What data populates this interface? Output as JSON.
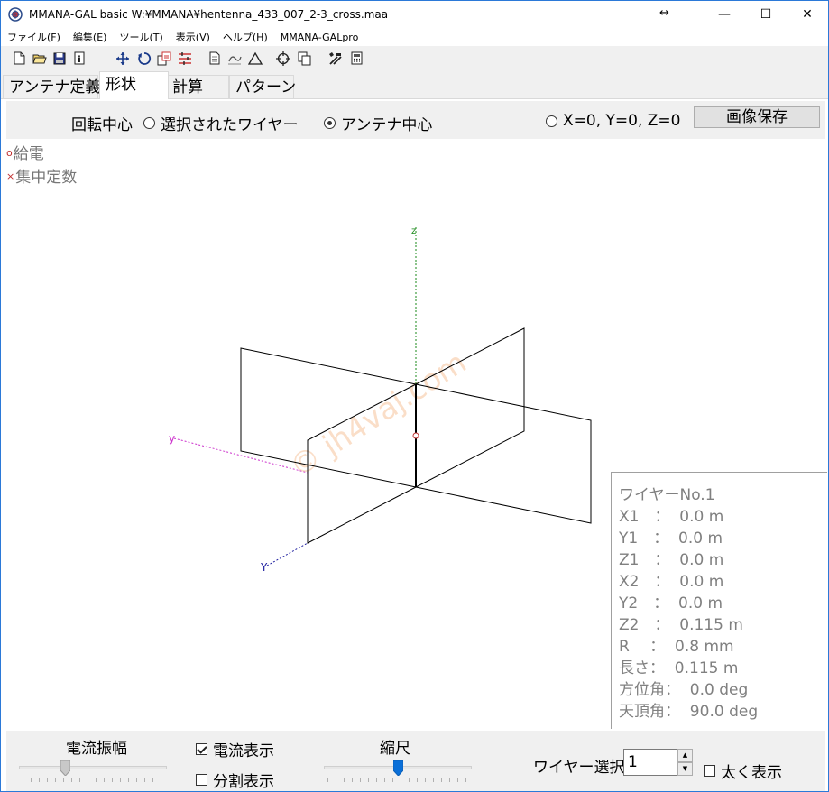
{
  "window": {
    "title": "MMANA-GAL basic W:¥MMANA¥hentenna_433_007_2-3_cross.maa",
    "resize_icon": "↔",
    "minimize": "—",
    "maximize": "☐",
    "close": "✕"
  },
  "menu": [
    "ファイル(F)",
    "編集(E)",
    "ツール(T)",
    "表示(V)",
    "ヘルプ(H)",
    "MMANA-GALpro"
  ],
  "toolbar_icons": [
    "new-file-icon",
    "open-folder-icon",
    "save-disk-icon",
    "info-icon",
    "move-arrows-icon",
    "rotate-icon",
    "copy-icon",
    "wire-list-icon",
    "document-icon",
    "draw-icon",
    "triangle-icon",
    "target-icon",
    "duplicate-icon",
    "tools-icon",
    "calculator-icon"
  ],
  "tabs": [
    "アンテナ定義",
    "形状",
    "計算",
    "パターン"
  ],
  "active_tab": "形状",
  "rotation": {
    "label": "回転中心",
    "option_wire": "選択されたワイヤー",
    "option_center": "アンテナ中心",
    "option_xyz": "X=0, Y=0, Z=0",
    "selected": "アンテナ中心",
    "save_button": "画像保存"
  },
  "legend": {
    "feed": "給電",
    "feed_mark": "o",
    "load": "集中定数",
    "load_mark": "×"
  },
  "axes": {
    "z_label": "z",
    "y_label": "y",
    "x_label": "Y",
    "watermark": "© jh4vaj.com"
  },
  "wire_info": {
    "title": "ワイヤーNo.1",
    "lines": [
      "X1　：  0.0 m",
      "Y1　：  0.0 m",
      "Z1　：  0.0 m",
      "X2　：  0.0 m",
      "Y2　：  0.0 m",
      "Z2　：  0.115 m",
      "R　 ：  0.8 mm",
      "長さ：  0.115 m",
      "方位角：  0.0 deg",
      "天頂角：  90.0 deg"
    ]
  },
  "bottom": {
    "current_amplitude": "電流振幅",
    "current_display": "電流表示",
    "current_display_checked": true,
    "segment_display": "分割表示",
    "segment_display_checked": false,
    "scale": "縮尺",
    "wire_select": "ワイヤー選択",
    "wire_select_value": "1",
    "bold_display": "太く表示",
    "bold_display_checked": false,
    "current_amplitude_level": 0.3,
    "scale_level": 0.5
  },
  "colors": {
    "title_border": "#2b79d8",
    "z_axis": "#1a8a1a",
    "y_axis": "#cc33cc",
    "x_axis": "#2020a0",
    "feed_point": "#c03030",
    "watermark": "#f0a060",
    "slider_thumb": "#0a6fd8"
  }
}
